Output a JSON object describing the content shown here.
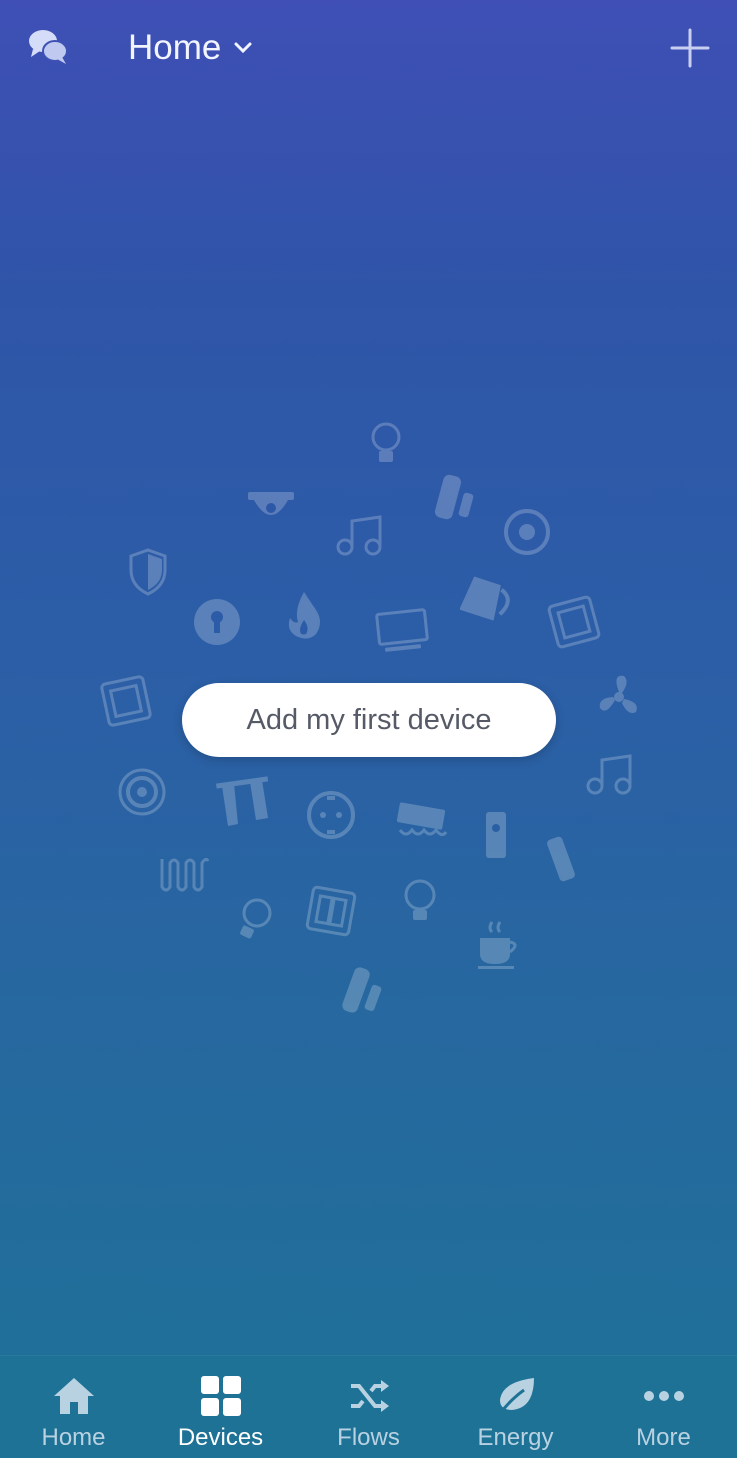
{
  "header": {
    "zone_title": "Home",
    "icons": {
      "left": "chat-bubbles-icon",
      "chevron": "chevron-down-icon",
      "right": "plus-icon"
    }
  },
  "empty_state": {
    "cta_label": "Add my first device",
    "decorative_icons": [
      "lightbulb-icon",
      "camera-icon",
      "music-note-icon",
      "sensor-icon",
      "speaker-icon",
      "shield-icon",
      "keyhole-icon",
      "flame-icon",
      "tv-icon",
      "kettle-icon",
      "switch-icon",
      "fan-icon",
      "thermostat-icon",
      "curtains-icon",
      "socket-icon",
      "heater-icon",
      "doorbell-icon",
      "remote-icon",
      "radiator-icon",
      "coffee-icon"
    ]
  },
  "tabbar": {
    "active": "Devices",
    "tabs": [
      {
        "label": "Home",
        "icon": "house-icon"
      },
      {
        "label": "Devices",
        "icon": "devices-grid-icon"
      },
      {
        "label": "Flows",
        "icon": "shuffle-icon"
      },
      {
        "label": "Energy",
        "icon": "leaf-icon"
      },
      {
        "label": "More",
        "icon": "more-dots-icon"
      }
    ]
  },
  "colors": {
    "background_top": "#3f4fb6",
    "background_bottom": "#1e7198",
    "tabbar": "#1d7296",
    "cta_text": "#555a66"
  }
}
